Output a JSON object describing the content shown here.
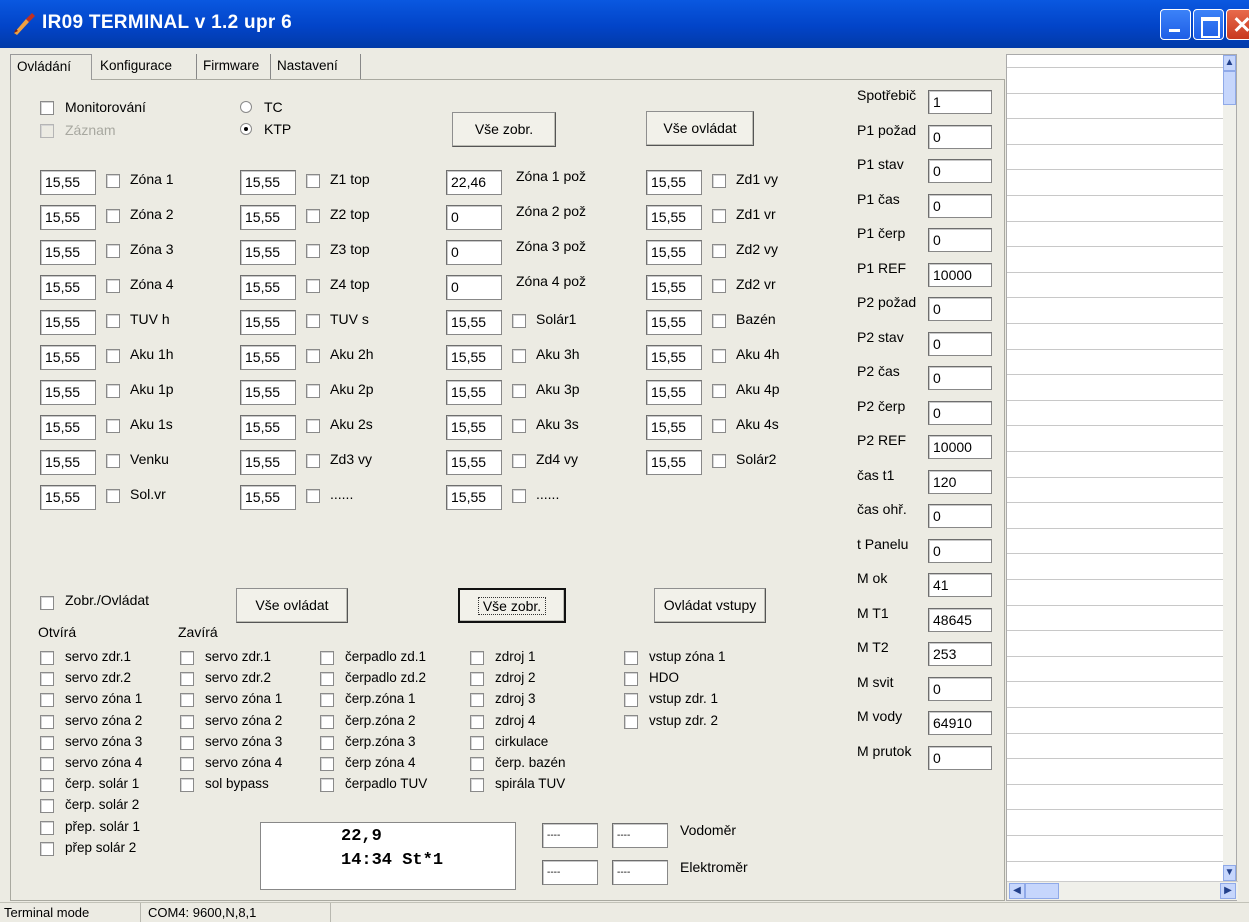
{
  "window": {
    "title": "IR09 TERMINAL v 1.2 upr 6"
  },
  "tabs": [
    "Ovládání",
    "Konfigurace",
    "Firmware",
    "Nastavení"
  ],
  "top_options": {
    "monitor": "Monitorování",
    "record": "Záznam",
    "radio_tc": "TC",
    "radio_ktp": "KTP",
    "selected": "KTP"
  },
  "buttons": {
    "vse_zobr_top": "Vše zobr.",
    "vse_ovladat_top": "Vše ovládat",
    "vse_ovladat_bottom": "Vše ovládat",
    "vse_zobr_bottom": "Vše zobr.",
    "ovladat_vstupy": "Ovládat vstupy"
  },
  "sensor_columns": [
    [
      [
        "15,55",
        "Zóna 1"
      ],
      [
        "15,55",
        "Zóna 2"
      ],
      [
        "15,55",
        "Zóna 3"
      ],
      [
        "15,55",
        "Zóna 4"
      ],
      [
        "15,55",
        "TUV h"
      ],
      [
        "15,55",
        "Aku 1h"
      ],
      [
        "15,55",
        "Aku 1p"
      ],
      [
        "15,55",
        "Aku 1s"
      ],
      [
        "15,55",
        "Venku"
      ],
      [
        "15,55",
        "Sol.vr"
      ]
    ],
    [
      [
        "15,55",
        "Z1 top"
      ],
      [
        "15,55",
        "Z2 top"
      ],
      [
        "15,55",
        "Z3 top"
      ],
      [
        "15,55",
        "Z4 top"
      ],
      [
        "15,55",
        "TUV s"
      ],
      [
        "15,55",
        "Aku 2h"
      ],
      [
        "15,55",
        "Aku 2p"
      ],
      [
        "15,55",
        "Aku 2s"
      ],
      [
        "15,55",
        "Zd3 vy"
      ],
      [
        "15,55",
        "......"
      ]
    ],
    [
      [
        "22,46",
        "Zóna 1 pož"
      ],
      [
        "0",
        "Zóna 2 pož"
      ],
      [
        "0",
        "Zóna 3 pož"
      ],
      [
        "0",
        "Zóna 4 pož"
      ],
      [
        "15,55",
        "Solár1"
      ],
      [
        "15,55",
        "Aku 3h"
      ],
      [
        "15,55",
        "Aku 3p"
      ],
      [
        "15,55",
        "Aku 3s"
      ],
      [
        "15,55",
        "Zd4 vy"
      ],
      [
        "15,55",
        "......"
      ]
    ],
    [
      [
        "15,55",
        "Zd1 vy"
      ],
      [
        "15,55",
        "Zd1 vr"
      ],
      [
        "15,55",
        "Zd2 vy"
      ],
      [
        "15,55",
        "Zd2 vr"
      ],
      [
        "15,55",
        "Bazén"
      ],
      [
        "15,55",
        "Aku 4h"
      ],
      [
        "15,55",
        "Aku 4p"
      ],
      [
        "15,55",
        "Aku 4s"
      ],
      [
        "15,55",
        "Solár2"
      ]
    ]
  ],
  "right_params": [
    [
      "Spotřebič",
      "1"
    ],
    [
      "P1 požad",
      "0"
    ],
    [
      "P1 stav",
      "0"
    ],
    [
      "P1 čas",
      "0"
    ],
    [
      "P1 čerp",
      "0"
    ],
    [
      "P1 REF",
      "10000"
    ],
    [
      "P2 požad",
      "0"
    ],
    [
      "P2 stav",
      "0"
    ],
    [
      "P2 čas",
      "0"
    ],
    [
      "P2 čerp",
      "0"
    ],
    [
      "P2 REF",
      "10000"
    ],
    [
      "čas t1",
      "120"
    ],
    [
      "čas ohř.",
      "0"
    ],
    [
      "t Panelu",
      "0"
    ],
    [
      "M ok",
      "41"
    ],
    [
      "M T1",
      "48645"
    ],
    [
      "M T2",
      "253"
    ],
    [
      "M svit",
      "0"
    ],
    [
      "M vody",
      "64910"
    ],
    [
      "M prutok",
      "0"
    ]
  ],
  "control": {
    "toggle_label": "Zobr./Ovládat",
    "header_open": "Otvírá",
    "header_close": "Zavírá",
    "columns": [
      [
        "servo zdr.1",
        "servo zdr.2",
        "servo zóna 1",
        "servo zóna 2",
        "servo zóna 3",
        "servo zóna 4",
        "čerp. solár 1",
        "čerp. solár 2",
        "přep. solár 1",
        "přep solár 2"
      ],
      [
        "servo zdr.1",
        "servo zdr.2",
        "servo zóna 1",
        "servo zóna 2",
        "servo zóna 3",
        "servo zóna 4",
        "sol bypass"
      ],
      [
        "čerpadlo zd.1",
        "čerpadlo zd.2",
        "čerp.zóna 1",
        "čerp.zóna 2",
        "čerp.zóna 3",
        "čerp zóna 4",
        "čerpadlo TUV"
      ],
      [
        "zdroj 1",
        "zdroj 2",
        "zdroj 3",
        "zdroj 4",
        "cirkulace",
        "čerp. bazén",
        "spirála TUV"
      ],
      [
        "vstup zóna 1",
        "HDO",
        "vstup zdr. 1",
        "vstup zdr. 2"
      ]
    ]
  },
  "display": {
    "line1": "22,9",
    "line2": "14:34 St*1"
  },
  "meters": {
    "water_label": "Vodoměr",
    "water_values": [
      "----",
      "----"
    ],
    "power_label": "Elektroměr",
    "power_values": [
      "----",
      "----"
    ]
  },
  "status": {
    "mode": "Terminal mode",
    "port": "COM4: 9600,N,8,1"
  }
}
